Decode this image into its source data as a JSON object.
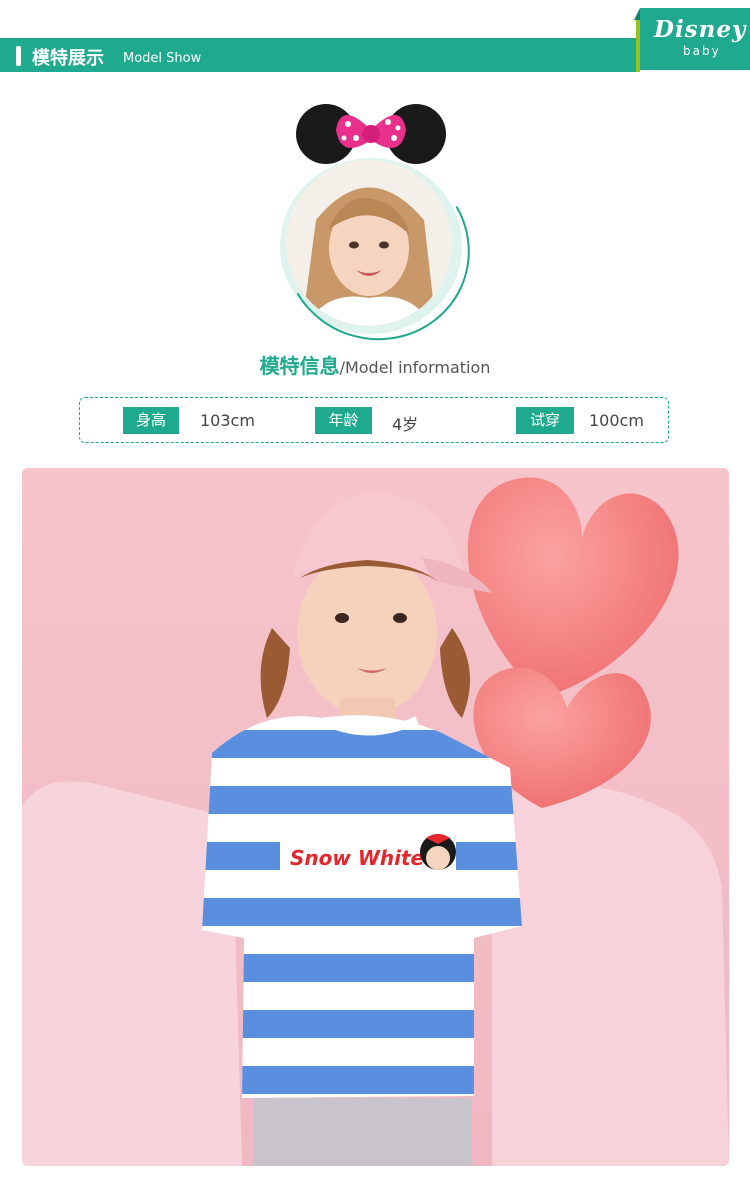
{
  "header": {
    "title_cn": "模特展示",
    "title_en": "Model Show",
    "brand_logo": "Disney",
    "brand_sub": "baby"
  },
  "model_info": {
    "title_cn": "模特信息",
    "title_en": "/Model information",
    "fields": [
      {
        "label": "身高",
        "value": "103cm"
      },
      {
        "label": "年龄",
        "value": "4岁"
      },
      {
        "label": "试穿",
        "value": "100cm"
      }
    ]
  },
  "photo": {
    "shirt_print": "Snow White"
  },
  "colors": {
    "accent": "#1fa98e",
    "logo_accent": "#98c21f",
    "photo_bg": "#f4c7cd",
    "stripe_blue": "#5a8fe0",
    "balloon": "#f48080"
  }
}
